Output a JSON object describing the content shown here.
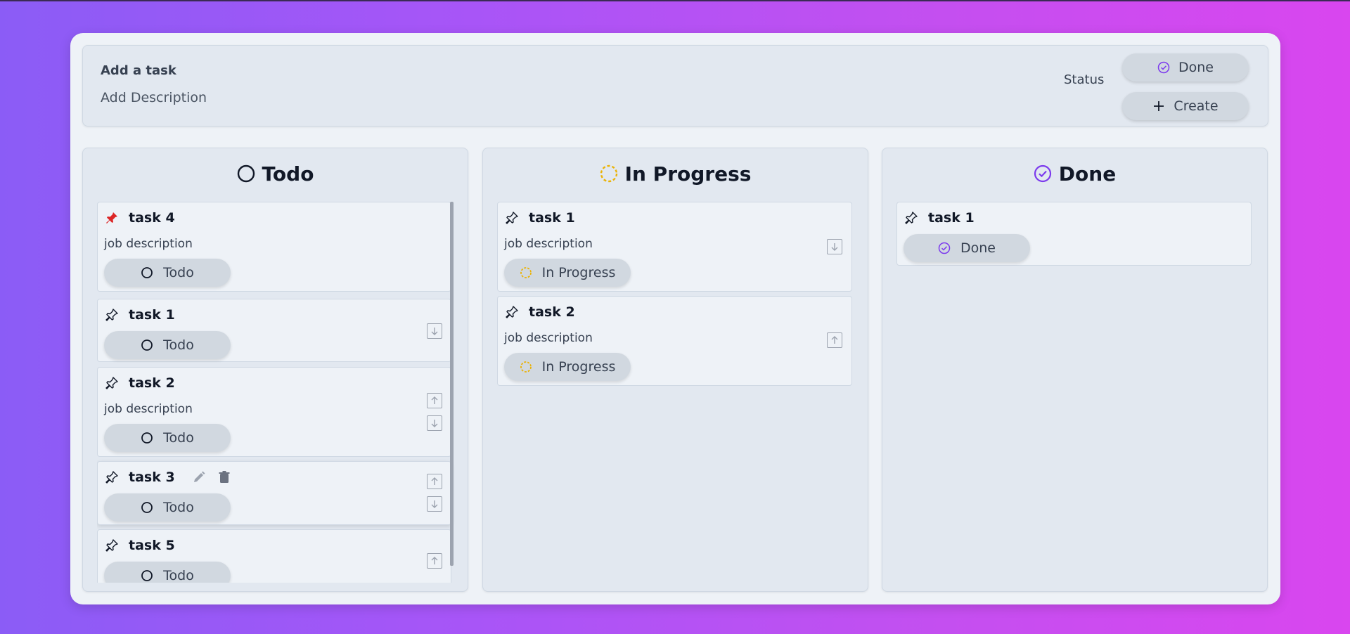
{
  "add_task": {
    "title_placeholder": "Add a task",
    "description_placeholder": "Add Description",
    "status_label": "Status",
    "status_value": "Done",
    "create_label": "Create"
  },
  "colors": {
    "todo": "#111827",
    "in_progress": "#eab308",
    "done": "#7c3aed",
    "pinned": "#dc2626"
  },
  "columns": [
    {
      "title": "Todo",
      "icon": "circle-icon",
      "tasks": [
        {
          "title": "task 4",
          "description": "job description",
          "status": "Todo",
          "pinned": true
        },
        {
          "title": "task 1",
          "description": "",
          "status": "Todo",
          "pinned": false
        },
        {
          "title": "task 2",
          "description": "job description",
          "status": "Todo",
          "pinned": false
        },
        {
          "title": "task 3",
          "description": "",
          "status": "Todo",
          "pinned": false
        },
        {
          "title": "task 5",
          "description": "",
          "status": "Todo",
          "pinned": false
        }
      ]
    },
    {
      "title": "In Progress",
      "icon": "dashed-circle-icon",
      "tasks": [
        {
          "title": "task 1",
          "description": "job description",
          "status": "In Progress",
          "pinned": false
        },
        {
          "title": "task 2",
          "description": "job description",
          "status": "In Progress",
          "pinned": false
        }
      ]
    },
    {
      "title": "Done",
      "icon": "check-circle-icon",
      "tasks": [
        {
          "title": "task 1",
          "description": "",
          "status": "Done",
          "pinned": false
        }
      ]
    }
  ]
}
